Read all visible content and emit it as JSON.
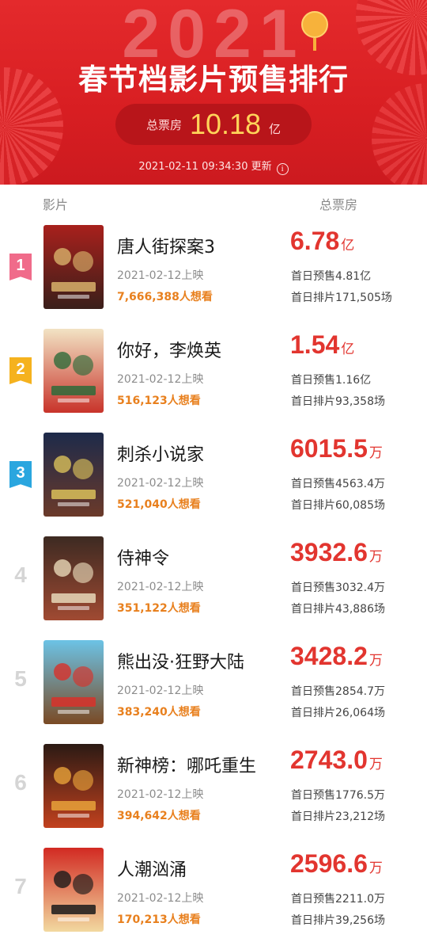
{
  "header": {
    "year": "2021",
    "title": "春节档影片预售排行",
    "total_label": "总票房",
    "total_value": "10.18",
    "total_unit": "亿",
    "updated": "2021-02-11 09:34:30 更新"
  },
  "columns": {
    "film": "影片",
    "box": "总票房"
  },
  "movies": [
    {
      "rank": "1",
      "rank_color": "#f06b8a",
      "title": "唐人街探案3",
      "release": "2021-02-12上映",
      "want": "7,666,388人想看",
      "gross": "6.78",
      "unit": "亿",
      "presale": "首日预售4.81亿",
      "shows": "首日排片171,505场",
      "poster_colors": [
        "#a8201c",
        "#3a1f1a",
        "#d8b26a"
      ]
    },
    {
      "rank": "2",
      "rank_color": "#f5b21e",
      "title": "你好，李焕英",
      "release": "2021-02-12上映",
      "want": "516,123人想看",
      "gross": "1.54",
      "unit": "亿",
      "presale": "首日预售1.16亿",
      "shows": "首日排片93,358场",
      "poster_colors": [
        "#f2e3c4",
        "#c8332a",
        "#2e6b3a"
      ]
    },
    {
      "rank": "3",
      "rank_color": "#2aa6df",
      "title": "刺杀小说家",
      "release": "2021-02-12上映",
      "want": "521,040人想看",
      "gross": "6015.5",
      "unit": "万",
      "presale": "首日预售4563.4万",
      "shows": "首日排片60,085场",
      "poster_colors": [
        "#1d2a4a",
        "#6b3a2a",
        "#d9c05a"
      ]
    },
    {
      "rank": "4",
      "rank_color": "#d5d5d5",
      "title": "侍神令",
      "release": "2021-02-12上映",
      "want": "351,122人想看",
      "gross": "3932.6",
      "unit": "万",
      "presale": "首日预售3032.4万",
      "shows": "首日排片43,886场",
      "poster_colors": [
        "#3d2a22",
        "#a04a32",
        "#e8d8b8"
      ]
    },
    {
      "rank": "5",
      "rank_color": "#d5d5d5",
      "title": "熊出没·狂野大陆",
      "release": "2021-02-12上映",
      "want": "383,240人想看",
      "gross": "3428.2",
      "unit": "万",
      "presale": "首日预售2854.7万",
      "shows": "首日排片26,064场",
      "poster_colors": [
        "#6cc3e6",
        "#7a4a24",
        "#d8312a"
      ]
    },
    {
      "rank": "6",
      "rank_color": "#d5d5d5",
      "title": "新神榜：哪吒重生",
      "release": "2021-02-12上映",
      "want": "394,642人想看",
      "gross": "2743.0",
      "unit": "万",
      "presale": "首日预售1776.5万",
      "shows": "首日排片23,212场",
      "poster_colors": [
        "#2b1a14",
        "#c2411e",
        "#e8a23a"
      ]
    },
    {
      "rank": "7",
      "rank_color": "#d5d5d5",
      "title": "人潮汹涌",
      "release": "2021-02-12上映",
      "want": "170,213人想看",
      "gross": "2596.6",
      "unit": "万",
      "presale": "首日预售2211.0万",
      "shows": "首日排片39,256场",
      "poster_colors": [
        "#d22a22",
        "#f2d9a0",
        "#1a1a1a"
      ]
    }
  ]
}
